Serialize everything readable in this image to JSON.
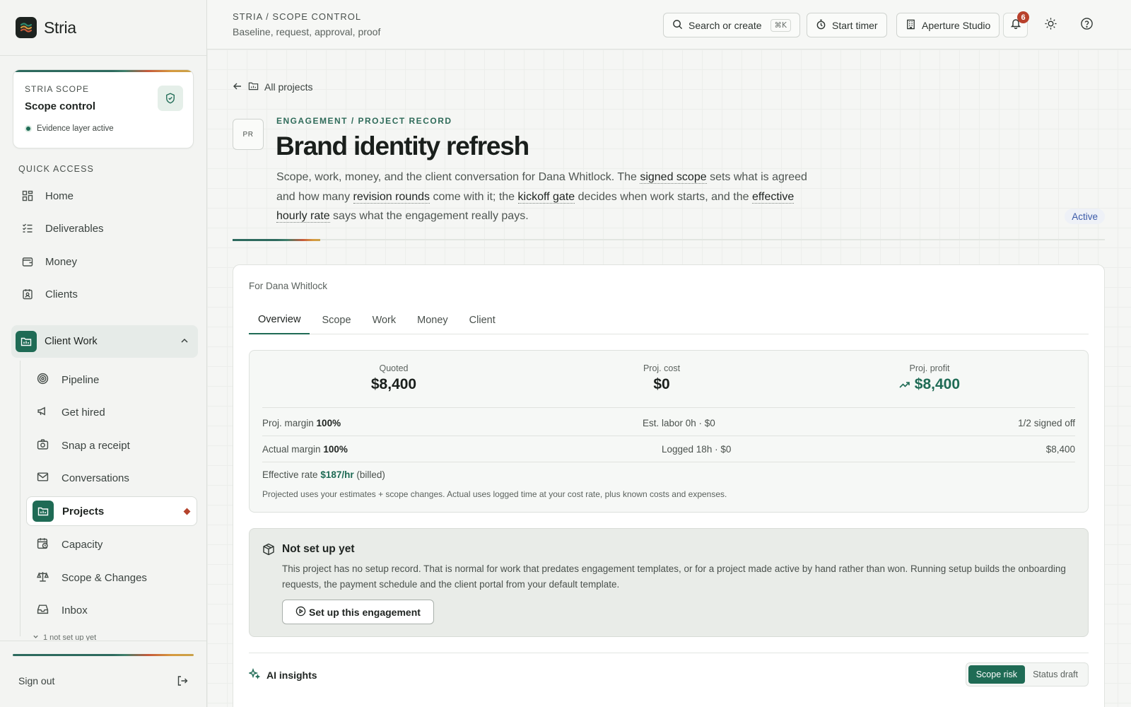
{
  "app": {
    "name": "Stria"
  },
  "scope_card": {
    "eyebrow": "STRIA SCOPE",
    "title": "Scope control",
    "status": "Evidence layer active"
  },
  "sidebar": {
    "quick_access_label": "QUICK ACCESS",
    "quick_items": [
      {
        "label": "Home",
        "icon": "grid-icon"
      },
      {
        "label": "Deliverables",
        "icon": "checklist-icon"
      },
      {
        "label": "Money",
        "icon": "wallet-icon"
      },
      {
        "label": "Clients",
        "icon": "badge-icon"
      }
    ],
    "group": {
      "label": "Client Work",
      "icon": "folder-chart-icon",
      "expanded": true
    },
    "sub_items": [
      {
        "label": "Pipeline",
        "icon": "target-icon"
      },
      {
        "label": "Get hired",
        "icon": "megaphone-icon"
      },
      {
        "label": "Snap a receipt",
        "icon": "camera-icon"
      },
      {
        "label": "Conversations",
        "icon": "mail-icon"
      },
      {
        "label": "Projects",
        "icon": "folder-chart-icon",
        "active": true
      },
      {
        "label": "Capacity",
        "icon": "calendar-clock-icon"
      },
      {
        "label": "Scope & Changes",
        "icon": "scale-icon"
      },
      {
        "label": "Inbox",
        "icon": "inbox-icon"
      }
    ],
    "more_text": "1 not set up yet",
    "signout": "Sign out"
  },
  "topbar": {
    "breadcrumb": "STRIA / SCOPE CONTROL",
    "subtitle": "Baseline, request, approval, proof",
    "search_label": "Search or create",
    "search_shortcut": "⌘K",
    "timer_label": "Start timer",
    "workspace_label": "Aperture Studio",
    "notification_count": "6"
  },
  "page": {
    "back_label": "All projects",
    "badge": "PR",
    "eyebrow": "ENGAGEMENT / PROJECT RECORD",
    "title": "Brand identity refresh",
    "desc": {
      "p1": "Scope, work, money, and the client conversation for Dana Whitlock. The ",
      "t1": "signed scope",
      "p2": " sets what is agreed and how many ",
      "t2": "revision rounds",
      "p3": " come with it; the ",
      "t3": "kickoff gate",
      "p4": " decides when work starts, and the ",
      "t4": "effective hourly rate",
      "p5": " says what the engagement really pays."
    },
    "status": "Active"
  },
  "panel": {
    "for_label": "For Dana Whitlock",
    "tabs": [
      "Overview",
      "Scope",
      "Work",
      "Money",
      "Client"
    ],
    "active_tab": "Overview"
  },
  "financials": {
    "quoted_label": "Quoted",
    "quoted": "$8,400",
    "cost_label": "Proj. cost",
    "cost": "$0",
    "profit_label": "Proj. profit",
    "profit": "$8,400",
    "proj_margin_label": "Proj. margin",
    "proj_margin": "100%",
    "est_labor": "Est. labor 0h · $0",
    "signed_off": "1/2 signed off",
    "actual_margin_label": "Actual margin",
    "actual_margin": "100%",
    "logged": "Logged 18h · $0",
    "actual_value": "$8,400",
    "rate_label": "Effective rate",
    "rate": "$187/hr",
    "rate_suffix": "(billed)",
    "note": "Projected uses your estimates + scope changes. Actual uses logged time at your cost rate, plus known costs and expenses."
  },
  "setup": {
    "title": "Not set up yet",
    "text": "This project has no setup record. That is normal for work that predates engagement templates, or for a project made active by hand rather than won. Running setup builds the onboarding requests, the payment schedule and the client portal from your default template.",
    "button": "Set up this engagement"
  },
  "ai": {
    "label": "AI insights",
    "options": [
      "Scope risk",
      "Status draft"
    ],
    "selected": "Scope risk"
  },
  "colors": {
    "accent": "#1f6b55",
    "alert": "#b8412c",
    "status_blue": "#3b5aa8"
  }
}
